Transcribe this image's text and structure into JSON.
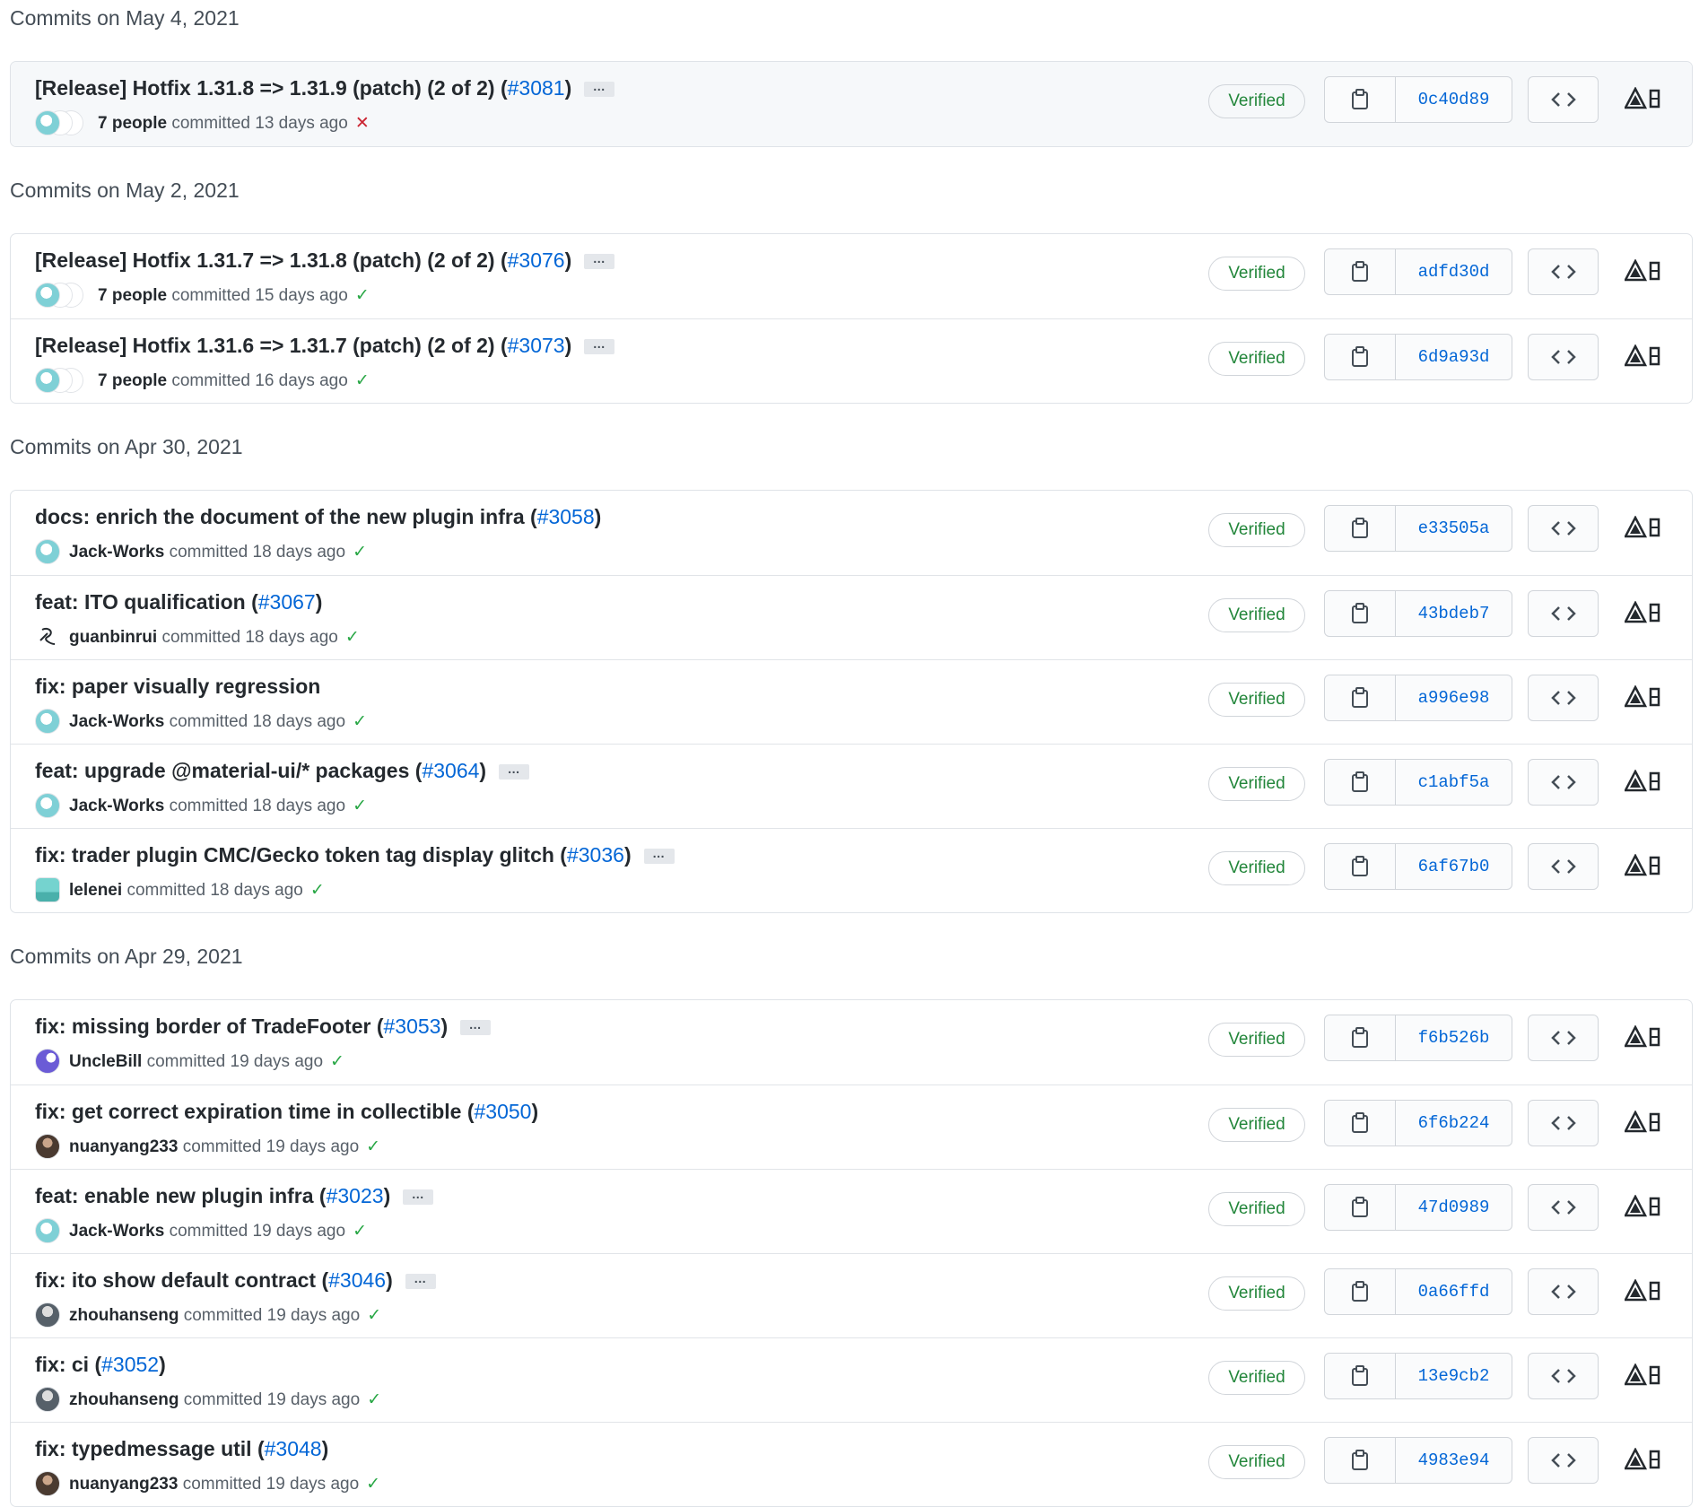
{
  "groups": [
    {
      "heading": "Commits on May 4, 2021",
      "commits": [
        {
          "title": "[Release] Hotfix 1.31.8 => 1.31.9 (patch) (2 of 2) (",
          "pr": "#3081",
          "close": ")",
          "ellipsis": true,
          "author": "7 people",
          "committed": "committed 13 days ago",
          "status": "✕",
          "status_type": "fail",
          "verified": "Verified",
          "sha": "0c40d89",
          "avatar": "multi",
          "highlight": true
        }
      ]
    },
    {
      "heading": "Commits on May 2, 2021",
      "commits": [
        {
          "title": "[Release] Hotfix 1.31.7 => 1.31.8 (patch) (2 of 2) (",
          "pr": "#3076",
          "close": ")",
          "ellipsis": true,
          "author": "7 people",
          "committed": "committed 15 days ago",
          "status": "✓",
          "status_type": "ok",
          "verified": "Verified",
          "sha": "adfd30d",
          "avatar": "multi"
        },
        {
          "title": "[Release] Hotfix 1.31.6 => 1.31.7 (patch) (2 of 2) (",
          "pr": "#3073",
          "close": ")",
          "ellipsis": true,
          "author": "7 people",
          "committed": "committed 16 days ago",
          "status": "✓",
          "status_type": "ok",
          "verified": "Verified",
          "sha": "6d9a93d",
          "avatar": "multi"
        }
      ]
    },
    {
      "heading": "Commits on Apr 30, 2021",
      "commits": [
        {
          "title": "docs: enrich the document of the new plugin infra (",
          "pr": "#3058",
          "close": ")",
          "ellipsis": false,
          "author": "Jack-Works",
          "committed": "committed 18 days ago",
          "status": "✓",
          "status_type": "ok",
          "verified": "Verified",
          "sha": "e33505a",
          "avatar": "teal"
        },
        {
          "title": "feat: ITO qualification (",
          "pr": "#3067",
          "close": ")",
          "ellipsis": false,
          "author": "guanbinrui",
          "committed": "committed 18 days ago",
          "status": "✓",
          "status_type": "ok",
          "verified": "Verified",
          "sha": "43bdeb7",
          "avatar": "guan"
        },
        {
          "title": "fix: paper visually regression",
          "pr": "",
          "close": "",
          "ellipsis": false,
          "author": "Jack-Works",
          "committed": "committed 18 days ago",
          "status": "✓",
          "status_type": "ok",
          "verified": "Verified",
          "sha": "a996e98",
          "avatar": "teal"
        },
        {
          "title": "feat: upgrade @material-ui/* packages (",
          "pr": "#3064",
          "close": ")",
          "ellipsis": true,
          "author": "Jack-Works",
          "committed": "committed 18 days ago",
          "status": "✓",
          "status_type": "ok",
          "verified": "Verified",
          "sha": "c1abf5a",
          "avatar": "teal"
        },
        {
          "title": "fix: trader plugin CMC/Gecko token tag display glitch (",
          "pr": "#3036",
          "close": ")",
          "ellipsis": true,
          "author": "lelenei",
          "committed": "committed 18 days ago",
          "status": "✓",
          "status_type": "ok",
          "verified": "Verified",
          "sha": "6af67b0",
          "avatar": "mint"
        }
      ]
    },
    {
      "heading": "Commits on Apr 29, 2021",
      "commits": [
        {
          "title": "fix: missing border of TradeFooter (",
          "pr": "#3053",
          "close": ")",
          "ellipsis": true,
          "author": "UncleBill",
          "committed": "committed 19 days ago",
          "status": "✓",
          "status_type": "ok",
          "verified": "Verified",
          "sha": "f6b526b",
          "avatar": "purple"
        },
        {
          "title": "fix: get correct expiration time in collectible (",
          "pr": "#3050",
          "close": ")",
          "ellipsis": false,
          "author": "nuanyang233",
          "committed": "committed 19 days ago",
          "status": "✓",
          "status_type": "ok",
          "verified": "Verified",
          "sha": "6f6b224",
          "avatar": "face"
        },
        {
          "title": "feat: enable new plugin infra (",
          "pr": "#3023",
          "close": ")",
          "ellipsis": true,
          "author": "Jack-Works",
          "committed": "committed 19 days ago",
          "status": "✓",
          "status_type": "ok",
          "verified": "Verified",
          "sha": "47d0989",
          "avatar": "teal"
        },
        {
          "title": "fix: ito show default contract (",
          "pr": "#3046",
          "close": ")",
          "ellipsis": true,
          "author": "zhouhanseng",
          "committed": "committed 19 days ago",
          "status": "✓",
          "status_type": "ok",
          "verified": "Verified",
          "sha": "0a66ffd",
          "avatar": "gray"
        },
        {
          "title": "fix: ci (",
          "pr": "#3052",
          "close": ")",
          "ellipsis": false,
          "author": "zhouhanseng",
          "committed": "committed 19 days ago",
          "status": "✓",
          "status_type": "ok",
          "verified": "Verified",
          "sha": "13e9cb2",
          "avatar": "gray"
        },
        {
          "title": "fix: typedmessage util (",
          "pr": "#3048",
          "close": ")",
          "ellipsis": false,
          "author": "nuanyang233",
          "committed": "committed 19 days ago",
          "status": "✓",
          "status_type": "ok",
          "verified": "Verified",
          "sha": "4983e94",
          "avatar": "face"
        }
      ]
    }
  ],
  "icons": {
    "copy": "clipboard-icon",
    "browse": "code-icon",
    "extension": "extension-icon"
  },
  "colors": {
    "link": "#0366d6",
    "verified": "#22863a",
    "success": "#28a745",
    "failure": "#cb2431"
  }
}
